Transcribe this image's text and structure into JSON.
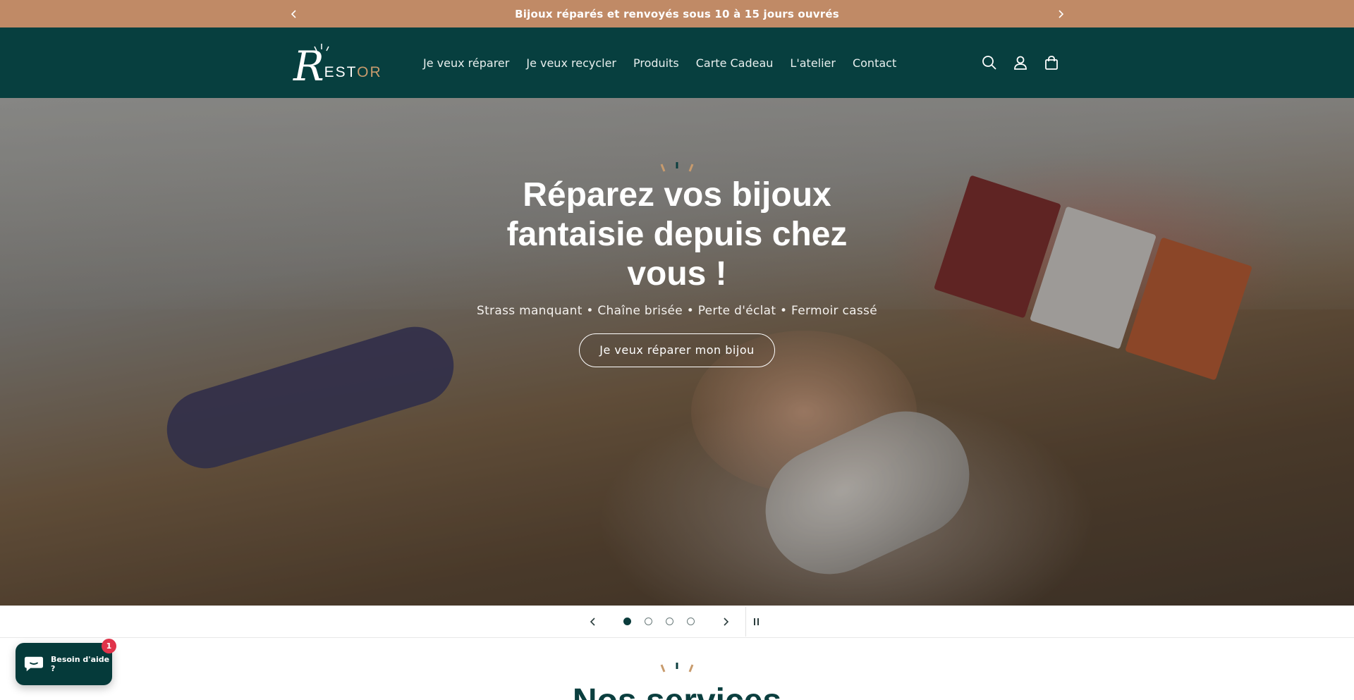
{
  "announcement": {
    "text": "Bijoux réparés et renvoyés sous 10 à 15 jours ouvrés",
    "prev_icon": "chevron-left-icon",
    "next_icon": "chevron-right-icon"
  },
  "header": {
    "logo": {
      "r": "R",
      "est": "EST",
      "or": "OR"
    },
    "nav": [
      {
        "label": "Je veux réparer"
      },
      {
        "label": "Je veux recycler"
      },
      {
        "label": "Produits"
      },
      {
        "label": "Carte Cadeau"
      },
      {
        "label": "L'atelier"
      },
      {
        "label": "Contact"
      }
    ],
    "icons": [
      "search-icon",
      "account-icon",
      "cart-icon"
    ]
  },
  "hero": {
    "title": "Réparez vos bijoux fantaisie depuis chez vous !",
    "subtitle": "Strass manquant • Chaîne brisée • Perte d'éclat • Fermoir cassé",
    "cta_label": "Je veux réparer mon bijou"
  },
  "slider": {
    "slide_count": 4,
    "active_slide": 1
  },
  "services": {
    "title": "Nos services"
  },
  "chat": {
    "label": "Besoin d'aide ?",
    "badge": "1"
  },
  "colors": {
    "announcement_bg": "#c08a66",
    "header_bg": "#073f3f",
    "accent_gold": "#c89b6d",
    "badge_red": "#e0334a"
  }
}
